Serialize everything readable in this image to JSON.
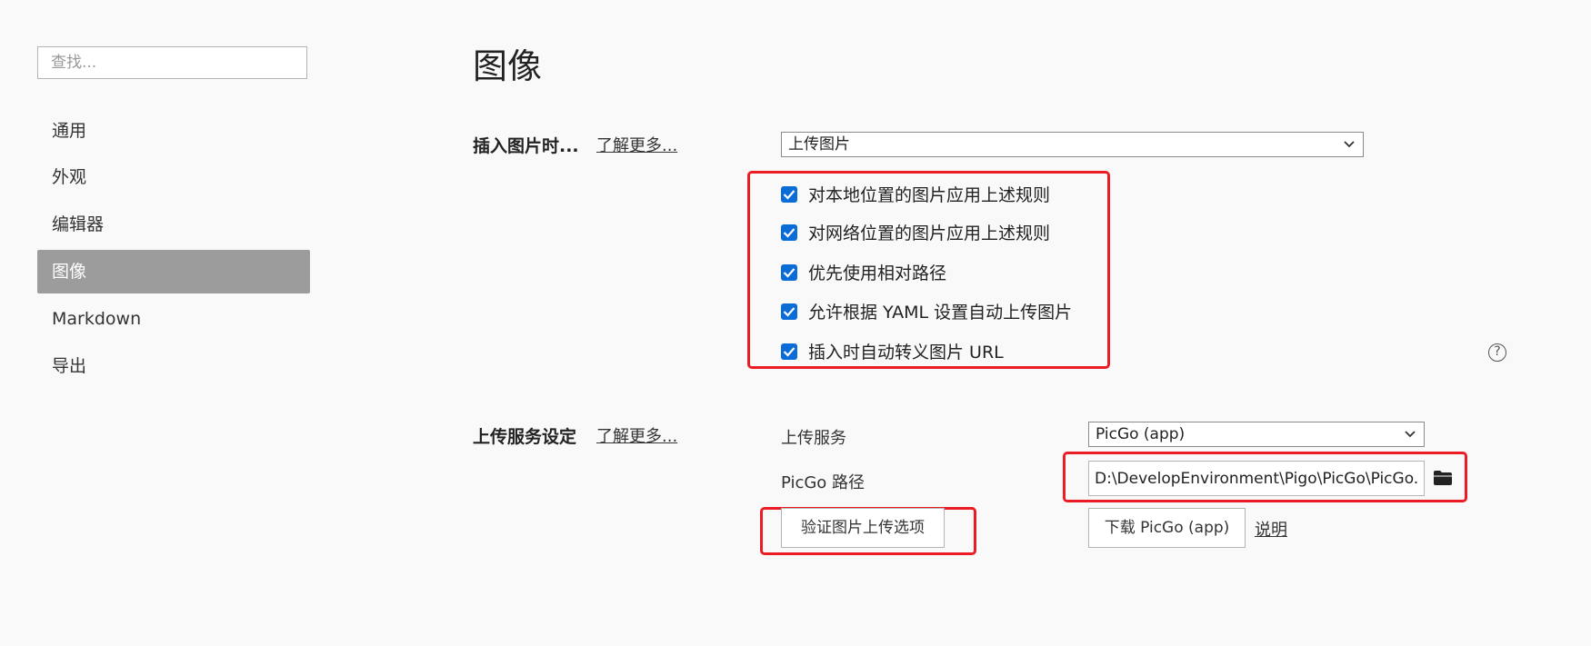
{
  "sidebar": {
    "search_placeholder": "查找...",
    "items": [
      {
        "label": "通用"
      },
      {
        "label": "外观"
      },
      {
        "label": "编辑器"
      },
      {
        "label": "图像"
      },
      {
        "label": "Markdown"
      },
      {
        "label": "导出"
      }
    ],
    "active_item": "图像"
  },
  "main": {
    "title": "图像",
    "insert_section": {
      "label": "插入图片时...",
      "learn_more": "了解更多...",
      "action_select": "上传图片",
      "options": [
        {
          "label": "对本地位置的图片应用上述规则",
          "checked": true
        },
        {
          "label": "对网络位置的图片应用上述规则",
          "checked": true
        },
        {
          "label": "优先使用相对路径",
          "checked": true
        },
        {
          "label": "允许根据 YAML 设置自动上传图片",
          "checked": true
        },
        {
          "label": "插入时自动转义图片 URL",
          "checked": true
        }
      ],
      "help_icon": "?"
    },
    "upload_section": {
      "label": "上传服务设定",
      "learn_more": "了解更多...",
      "service_label": "上传服务",
      "service_value": "PicGo (app)",
      "path_label": "PicGo 路径",
      "path_value": "D:\\DevelopEnvironment\\Pigo\\PicGo\\PicGo.exe",
      "verify_button": "验证图片上传选项",
      "download_button": "下载 PicGo (app)",
      "doc_link": "说明"
    }
  },
  "colors": {
    "accent": "#0a6cd6",
    "highlight": "#ec1c24",
    "sidebar_active": "#9c9c9c"
  }
}
